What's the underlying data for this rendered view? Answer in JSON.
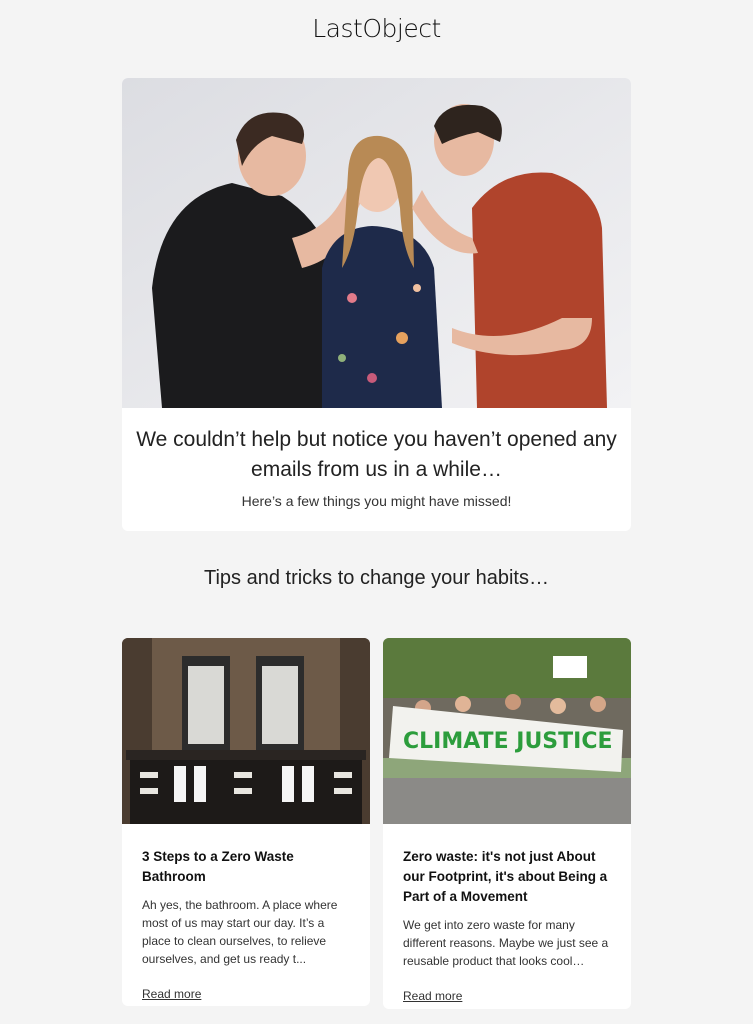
{
  "brand": {
    "logo_text": "LastObject"
  },
  "hero": {
    "image_icon": "people-photo",
    "headline": "We couldn’t help but notice you haven’t opened any emails from us in a while…",
    "subheadline": "Here’s a few things you might have missed!"
  },
  "tips": {
    "title": "Tips and tricks to change your habits…",
    "articles": [
      {
        "image_icon": "bathroom-photo",
        "title": "3 Steps to a Zero Waste Bathroom",
        "excerpt": "Ah yes, the bathroom. A place where most of us may start our day. It’s a place to clean ourselves, to relieve ourselves, and get us ready t...",
        "link_label": "Read more"
      },
      {
        "image_icon": "protest-photo",
        "title": "Zero waste: it's not just About our Footprint, it's about Being a Part of a Movement",
        "excerpt": "We get into zero waste for many different reasons. Maybe we just see a reusable product that looks cool…",
        "link_label": "Read more",
        "banner_text": "CLIMATE JUSTICE"
      }
    ]
  },
  "colors": {
    "page_bg": "#f4f4f4",
    "card_bg": "#ffffff",
    "text": "#222222"
  }
}
